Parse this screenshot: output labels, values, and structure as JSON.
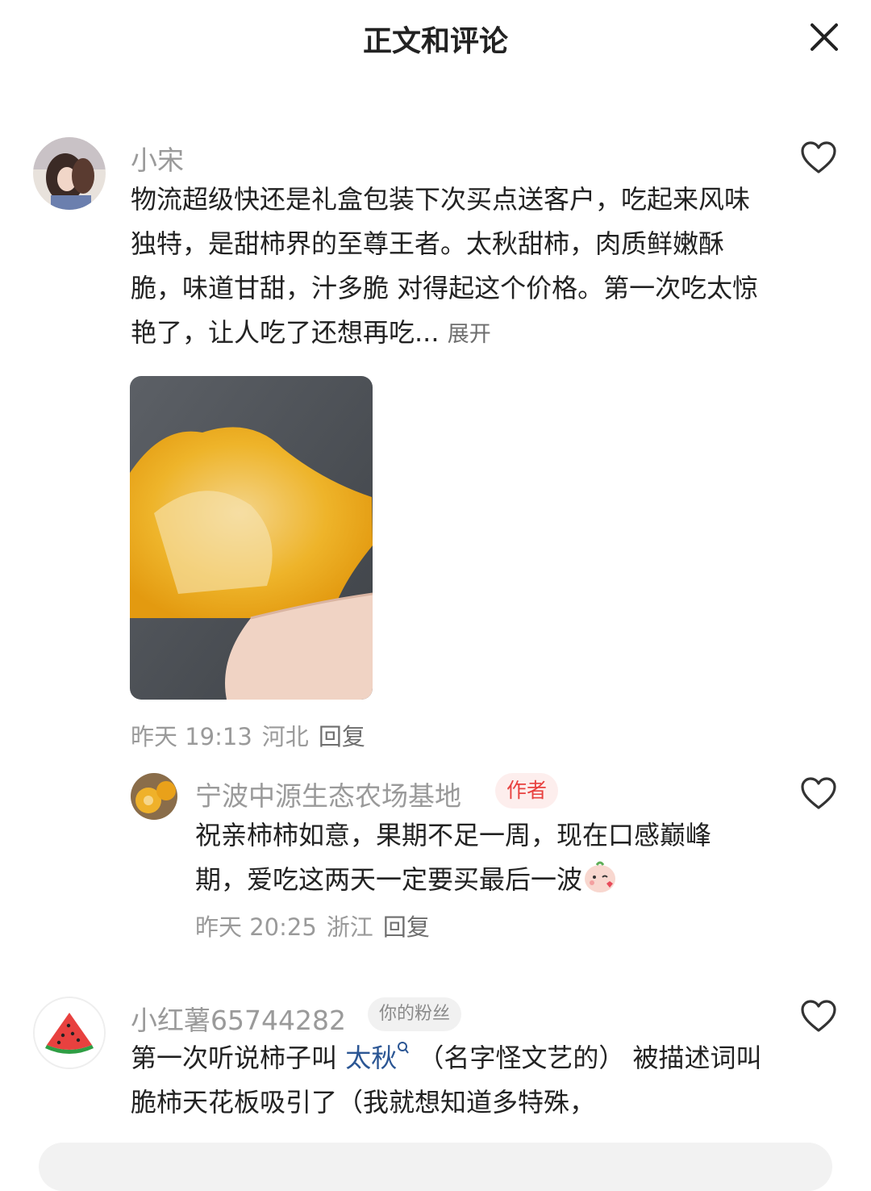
{
  "header": {
    "title": "正文和评论",
    "close_icon": "close-icon"
  },
  "comments": [
    {
      "username": "小宋",
      "text": "物流超级快还是礼盒包装下次买点送客户，吃起来风味独特，是甜柿界的至尊王者。太秋甜柿，肉质鲜嫩酥脆，味道甘甜，汁多脆 对得起这个价格。第一次吃太惊艳了，让人吃了还想再吃...",
      "expand": "展开",
      "meta": {
        "time": "昨天 19:13",
        "location": "河北",
        "reply": "回复"
      },
      "photo_icon": "persimmon-photo"
    }
  ],
  "reply": {
    "username": "宁波中源生态农场基地",
    "badge": "作者",
    "text": "祝亲柿柿如意，果期不足一周，现在口感巅峰期，爱吃这两天一定要买最后一波",
    "emoji": "kiss-emoji",
    "meta": {
      "time": "昨天 20:25",
      "location": "浙江",
      "reply": "回复"
    }
  },
  "comment2": {
    "username": "小红薯65744282",
    "badge": "你的粉丝",
    "text_before": "第一次听说柿子叫 ",
    "hashtag": "太秋",
    "text_after": " （名字怪文艺的） 被描述词叫脆柿天花板吸引了（我就想知道多特殊，",
    "avatar_icon": "watermelon-icon"
  },
  "colors": {
    "accent": "#e8413f",
    "link": "#2b5694",
    "muted": "#9a9a9a"
  }
}
